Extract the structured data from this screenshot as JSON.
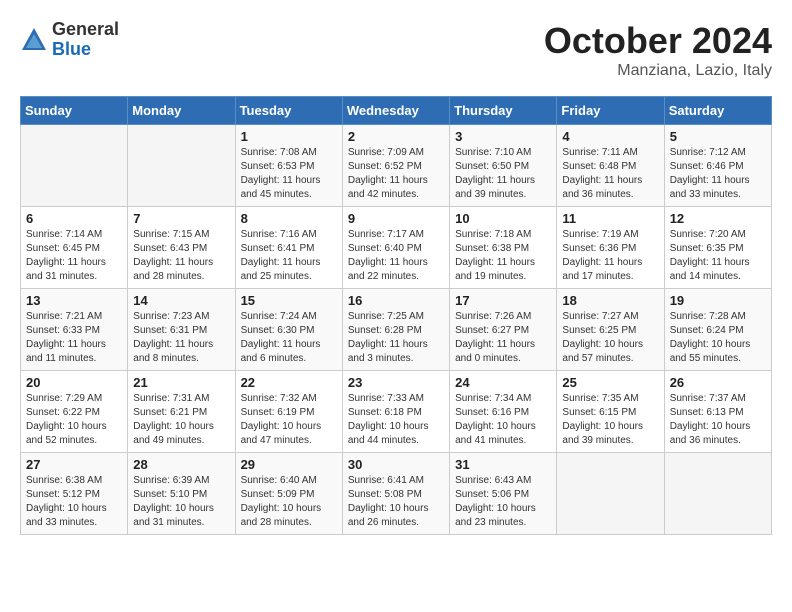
{
  "header": {
    "logo_general": "General",
    "logo_blue": "Blue",
    "month_title": "October 2024",
    "location": "Manziana, Lazio, Italy"
  },
  "days_of_week": [
    "Sunday",
    "Monday",
    "Tuesday",
    "Wednesday",
    "Thursday",
    "Friday",
    "Saturday"
  ],
  "weeks": [
    [
      {
        "day": "",
        "detail": ""
      },
      {
        "day": "",
        "detail": ""
      },
      {
        "day": "1",
        "detail": "Sunrise: 7:08 AM\nSunset: 6:53 PM\nDaylight: 11 hours and 45 minutes."
      },
      {
        "day": "2",
        "detail": "Sunrise: 7:09 AM\nSunset: 6:52 PM\nDaylight: 11 hours and 42 minutes."
      },
      {
        "day": "3",
        "detail": "Sunrise: 7:10 AM\nSunset: 6:50 PM\nDaylight: 11 hours and 39 minutes."
      },
      {
        "day": "4",
        "detail": "Sunrise: 7:11 AM\nSunset: 6:48 PM\nDaylight: 11 hours and 36 minutes."
      },
      {
        "day": "5",
        "detail": "Sunrise: 7:12 AM\nSunset: 6:46 PM\nDaylight: 11 hours and 33 minutes."
      }
    ],
    [
      {
        "day": "6",
        "detail": "Sunrise: 7:14 AM\nSunset: 6:45 PM\nDaylight: 11 hours and 31 minutes."
      },
      {
        "day": "7",
        "detail": "Sunrise: 7:15 AM\nSunset: 6:43 PM\nDaylight: 11 hours and 28 minutes."
      },
      {
        "day": "8",
        "detail": "Sunrise: 7:16 AM\nSunset: 6:41 PM\nDaylight: 11 hours and 25 minutes."
      },
      {
        "day": "9",
        "detail": "Sunrise: 7:17 AM\nSunset: 6:40 PM\nDaylight: 11 hours and 22 minutes."
      },
      {
        "day": "10",
        "detail": "Sunrise: 7:18 AM\nSunset: 6:38 PM\nDaylight: 11 hours and 19 minutes."
      },
      {
        "day": "11",
        "detail": "Sunrise: 7:19 AM\nSunset: 6:36 PM\nDaylight: 11 hours and 17 minutes."
      },
      {
        "day": "12",
        "detail": "Sunrise: 7:20 AM\nSunset: 6:35 PM\nDaylight: 11 hours and 14 minutes."
      }
    ],
    [
      {
        "day": "13",
        "detail": "Sunrise: 7:21 AM\nSunset: 6:33 PM\nDaylight: 11 hours and 11 minutes."
      },
      {
        "day": "14",
        "detail": "Sunrise: 7:23 AM\nSunset: 6:31 PM\nDaylight: 11 hours and 8 minutes."
      },
      {
        "day": "15",
        "detail": "Sunrise: 7:24 AM\nSunset: 6:30 PM\nDaylight: 11 hours and 6 minutes."
      },
      {
        "day": "16",
        "detail": "Sunrise: 7:25 AM\nSunset: 6:28 PM\nDaylight: 11 hours and 3 minutes."
      },
      {
        "day": "17",
        "detail": "Sunrise: 7:26 AM\nSunset: 6:27 PM\nDaylight: 11 hours and 0 minutes."
      },
      {
        "day": "18",
        "detail": "Sunrise: 7:27 AM\nSunset: 6:25 PM\nDaylight: 10 hours and 57 minutes."
      },
      {
        "day": "19",
        "detail": "Sunrise: 7:28 AM\nSunset: 6:24 PM\nDaylight: 10 hours and 55 minutes."
      }
    ],
    [
      {
        "day": "20",
        "detail": "Sunrise: 7:29 AM\nSunset: 6:22 PM\nDaylight: 10 hours and 52 minutes."
      },
      {
        "day": "21",
        "detail": "Sunrise: 7:31 AM\nSunset: 6:21 PM\nDaylight: 10 hours and 49 minutes."
      },
      {
        "day": "22",
        "detail": "Sunrise: 7:32 AM\nSunset: 6:19 PM\nDaylight: 10 hours and 47 minutes."
      },
      {
        "day": "23",
        "detail": "Sunrise: 7:33 AM\nSunset: 6:18 PM\nDaylight: 10 hours and 44 minutes."
      },
      {
        "day": "24",
        "detail": "Sunrise: 7:34 AM\nSunset: 6:16 PM\nDaylight: 10 hours and 41 minutes."
      },
      {
        "day": "25",
        "detail": "Sunrise: 7:35 AM\nSunset: 6:15 PM\nDaylight: 10 hours and 39 minutes."
      },
      {
        "day": "26",
        "detail": "Sunrise: 7:37 AM\nSunset: 6:13 PM\nDaylight: 10 hours and 36 minutes."
      }
    ],
    [
      {
        "day": "27",
        "detail": "Sunrise: 6:38 AM\nSunset: 5:12 PM\nDaylight: 10 hours and 33 minutes."
      },
      {
        "day": "28",
        "detail": "Sunrise: 6:39 AM\nSunset: 5:10 PM\nDaylight: 10 hours and 31 minutes."
      },
      {
        "day": "29",
        "detail": "Sunrise: 6:40 AM\nSunset: 5:09 PM\nDaylight: 10 hours and 28 minutes."
      },
      {
        "day": "30",
        "detail": "Sunrise: 6:41 AM\nSunset: 5:08 PM\nDaylight: 10 hours and 26 minutes."
      },
      {
        "day": "31",
        "detail": "Sunrise: 6:43 AM\nSunset: 5:06 PM\nDaylight: 10 hours and 23 minutes."
      },
      {
        "day": "",
        "detail": ""
      },
      {
        "day": "",
        "detail": ""
      }
    ]
  ]
}
